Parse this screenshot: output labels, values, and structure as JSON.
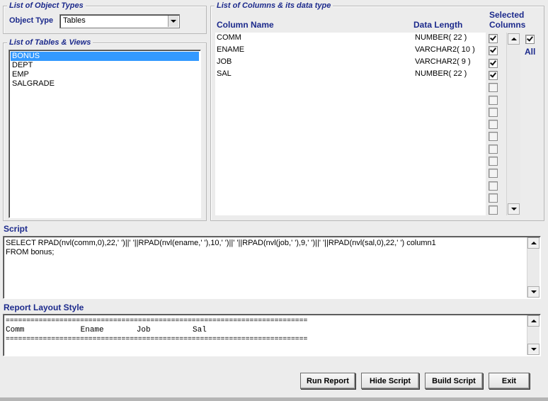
{
  "object_types_group": {
    "title": "List of Object Types",
    "object_type_label": "Object Type",
    "object_type_value": "Tables"
  },
  "tables_group": {
    "title": "List of Tables & Views",
    "items": [
      "BONUS",
      "DEPT",
      "EMP",
      "SALGRADE"
    ],
    "selected": "BONUS"
  },
  "columns_group": {
    "title": "List of Columns & its data type",
    "headers": {
      "column_name": "Column Name",
      "data_length": "Data Length",
      "selected": "Selected Columns"
    },
    "rows": [
      {
        "name": "COMM",
        "type": "NUMBER( 22 )",
        "checked": true
      },
      {
        "name": "ENAME",
        "type": "VARCHAR2( 10 )",
        "checked": true
      },
      {
        "name": "JOB",
        "type": "VARCHAR2( 9 )",
        "checked": true
      },
      {
        "name": "SAL",
        "type": "NUMBER( 22 )",
        "checked": true
      }
    ],
    "empty_checkbox_count": 11,
    "all_label": "All",
    "all_checked": true
  },
  "script": {
    "title": "Script",
    "line1": "SELECT RPAD(nvl(comm,0),22,' ')||'   '||RPAD(nvl(ename,' '),10,' ')||'   '||RPAD(nvl(job,' '),9,' ')||'   '||RPAD(nvl(sal,0),22,' ') column1",
    "line2": " FROM bonus;"
  },
  "report_layout": {
    "title": "Report Layout Style",
    "rule": "=========================================================================",
    "columns_line": "Comm            Ename       Job         Sal"
  },
  "buttons": {
    "run_report": "Run Report",
    "hide_script": "Hide Script",
    "build_script": "Build Script",
    "exit": "Exit"
  }
}
